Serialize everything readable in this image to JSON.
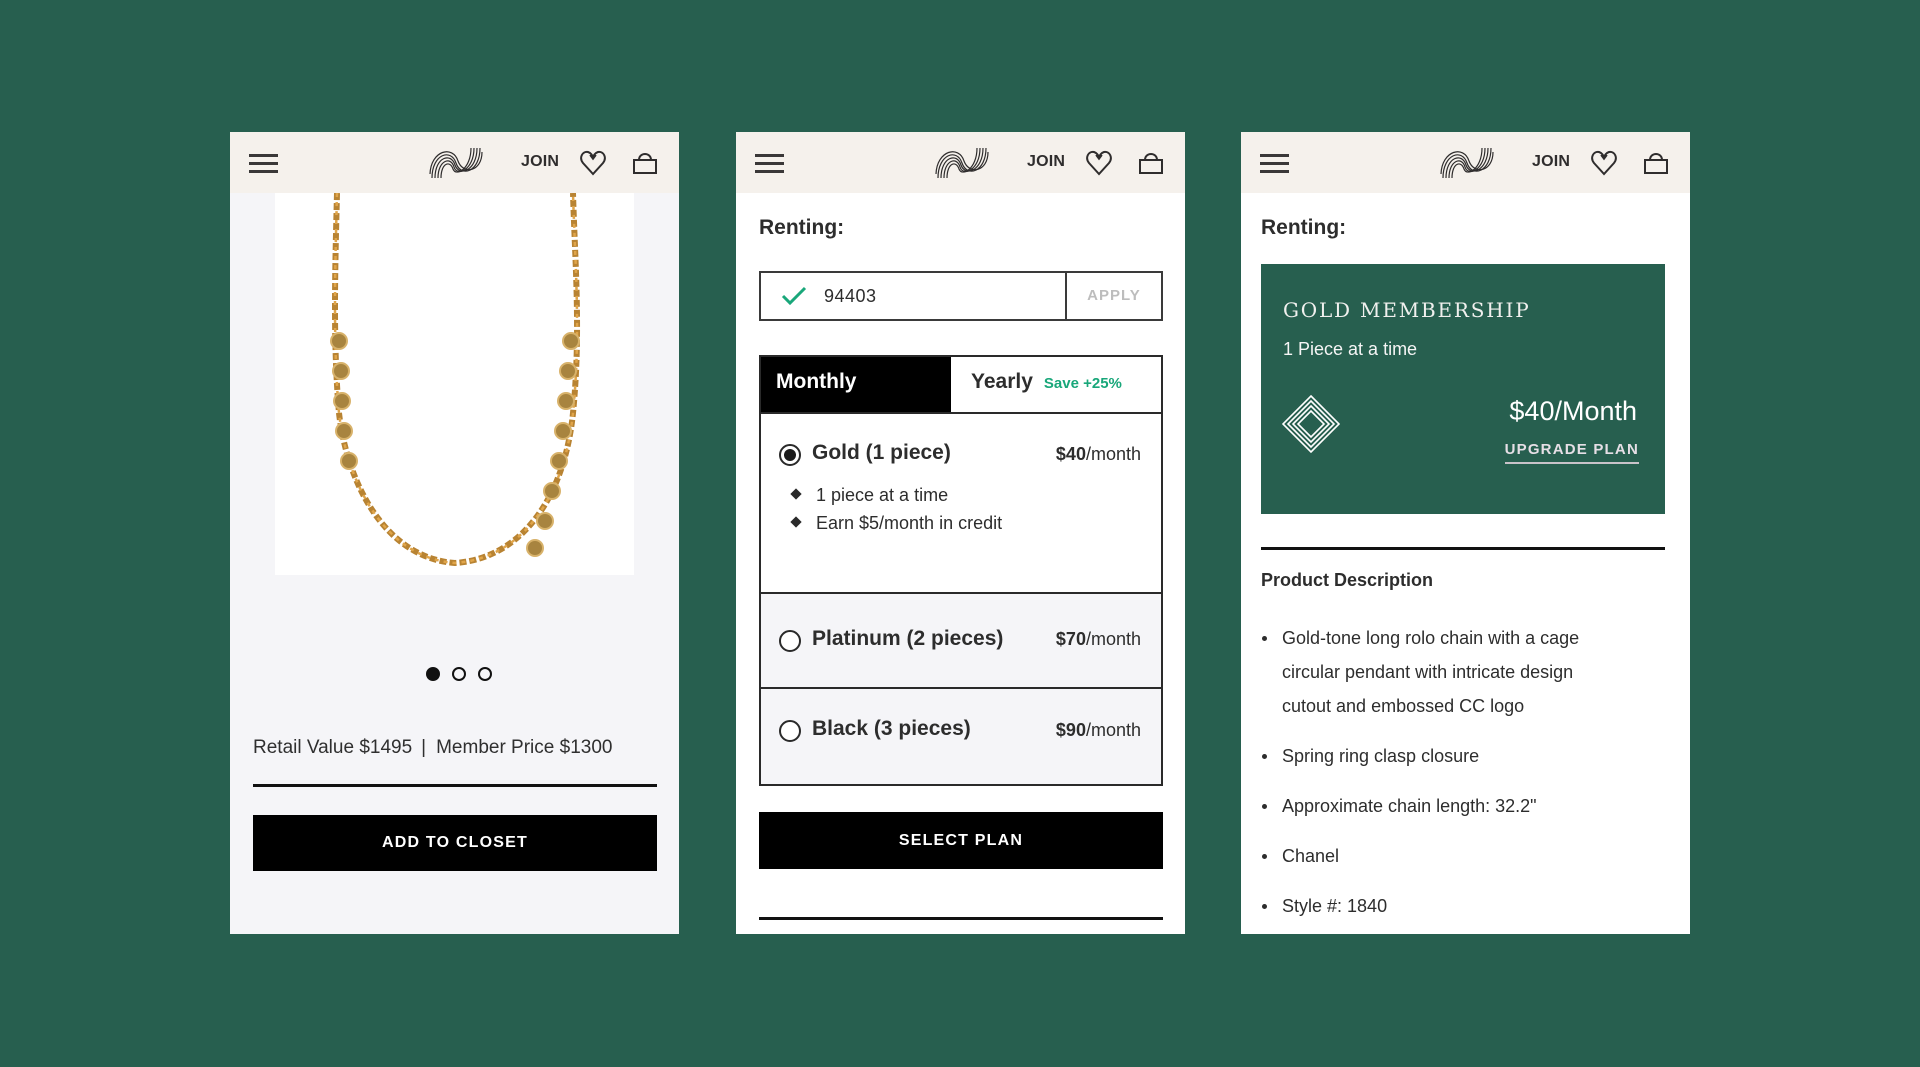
{
  "header": {
    "menu_icon": "hamburger-menu-icon",
    "logo_icon": "brand-logo-icon",
    "join_label": "JOIN",
    "wishlist_icon": "heart-icon",
    "bag_icon": "shopping-bag-icon"
  },
  "product_page": {
    "image_alt": "Gold-tone long rolo chain necklace",
    "carousel": {
      "total": 3,
      "active_index": 0
    },
    "retail_value": "Retail Value $1495",
    "separator": "|",
    "member_price": "Member Price $1300",
    "add_to_closet_label": "ADD TO CLOSET"
  },
  "plan_page": {
    "renting_label": "Renting:",
    "zip": {
      "value": "94403",
      "valid": true,
      "apply_label": "APPLY"
    },
    "tabs": [
      {
        "label": "Monthly",
        "active": true
      },
      {
        "label": "Yearly",
        "active": false,
        "badge": "Save +25%"
      }
    ],
    "plans": [
      {
        "name": "Gold (1 piece)",
        "price_amount": "$40",
        "price_unit": "/month",
        "selected": true,
        "features": [
          "1 piece at a time",
          "Earn $5/month in credit"
        ]
      },
      {
        "name": "Platinum (2 pieces)",
        "price_amount": "$70",
        "price_unit": "/month",
        "selected": false
      },
      {
        "name": "Black (3 pieces)",
        "price_amount": "$90",
        "price_unit": "/month",
        "selected": false
      }
    ],
    "select_plan_label": "SELECT PLAN"
  },
  "membership_page": {
    "renting_label": "Renting:",
    "card": {
      "title": "GOLD MEMBERSHIP",
      "subtitle": "1 Piece at a time",
      "price": "$40/Month",
      "upgrade_label": "UPGRADE PLAN",
      "icon": "diamond-icon"
    },
    "description_title": "Product Description",
    "description_items": [
      "Gold-tone long rolo chain with a cage circular pendant with intricate design cutout and embossed CC logo",
      "Spring ring clasp closure",
      "Approximate chain length: 32.2\"",
      "Chanel",
      "Style #: 1840"
    ]
  },
  "colors": {
    "background": "#275f4f",
    "header_bg": "#f5f1ec",
    "accent_green": "#19a77a",
    "card_green": "#275f4f",
    "button_black": "#000000"
  }
}
